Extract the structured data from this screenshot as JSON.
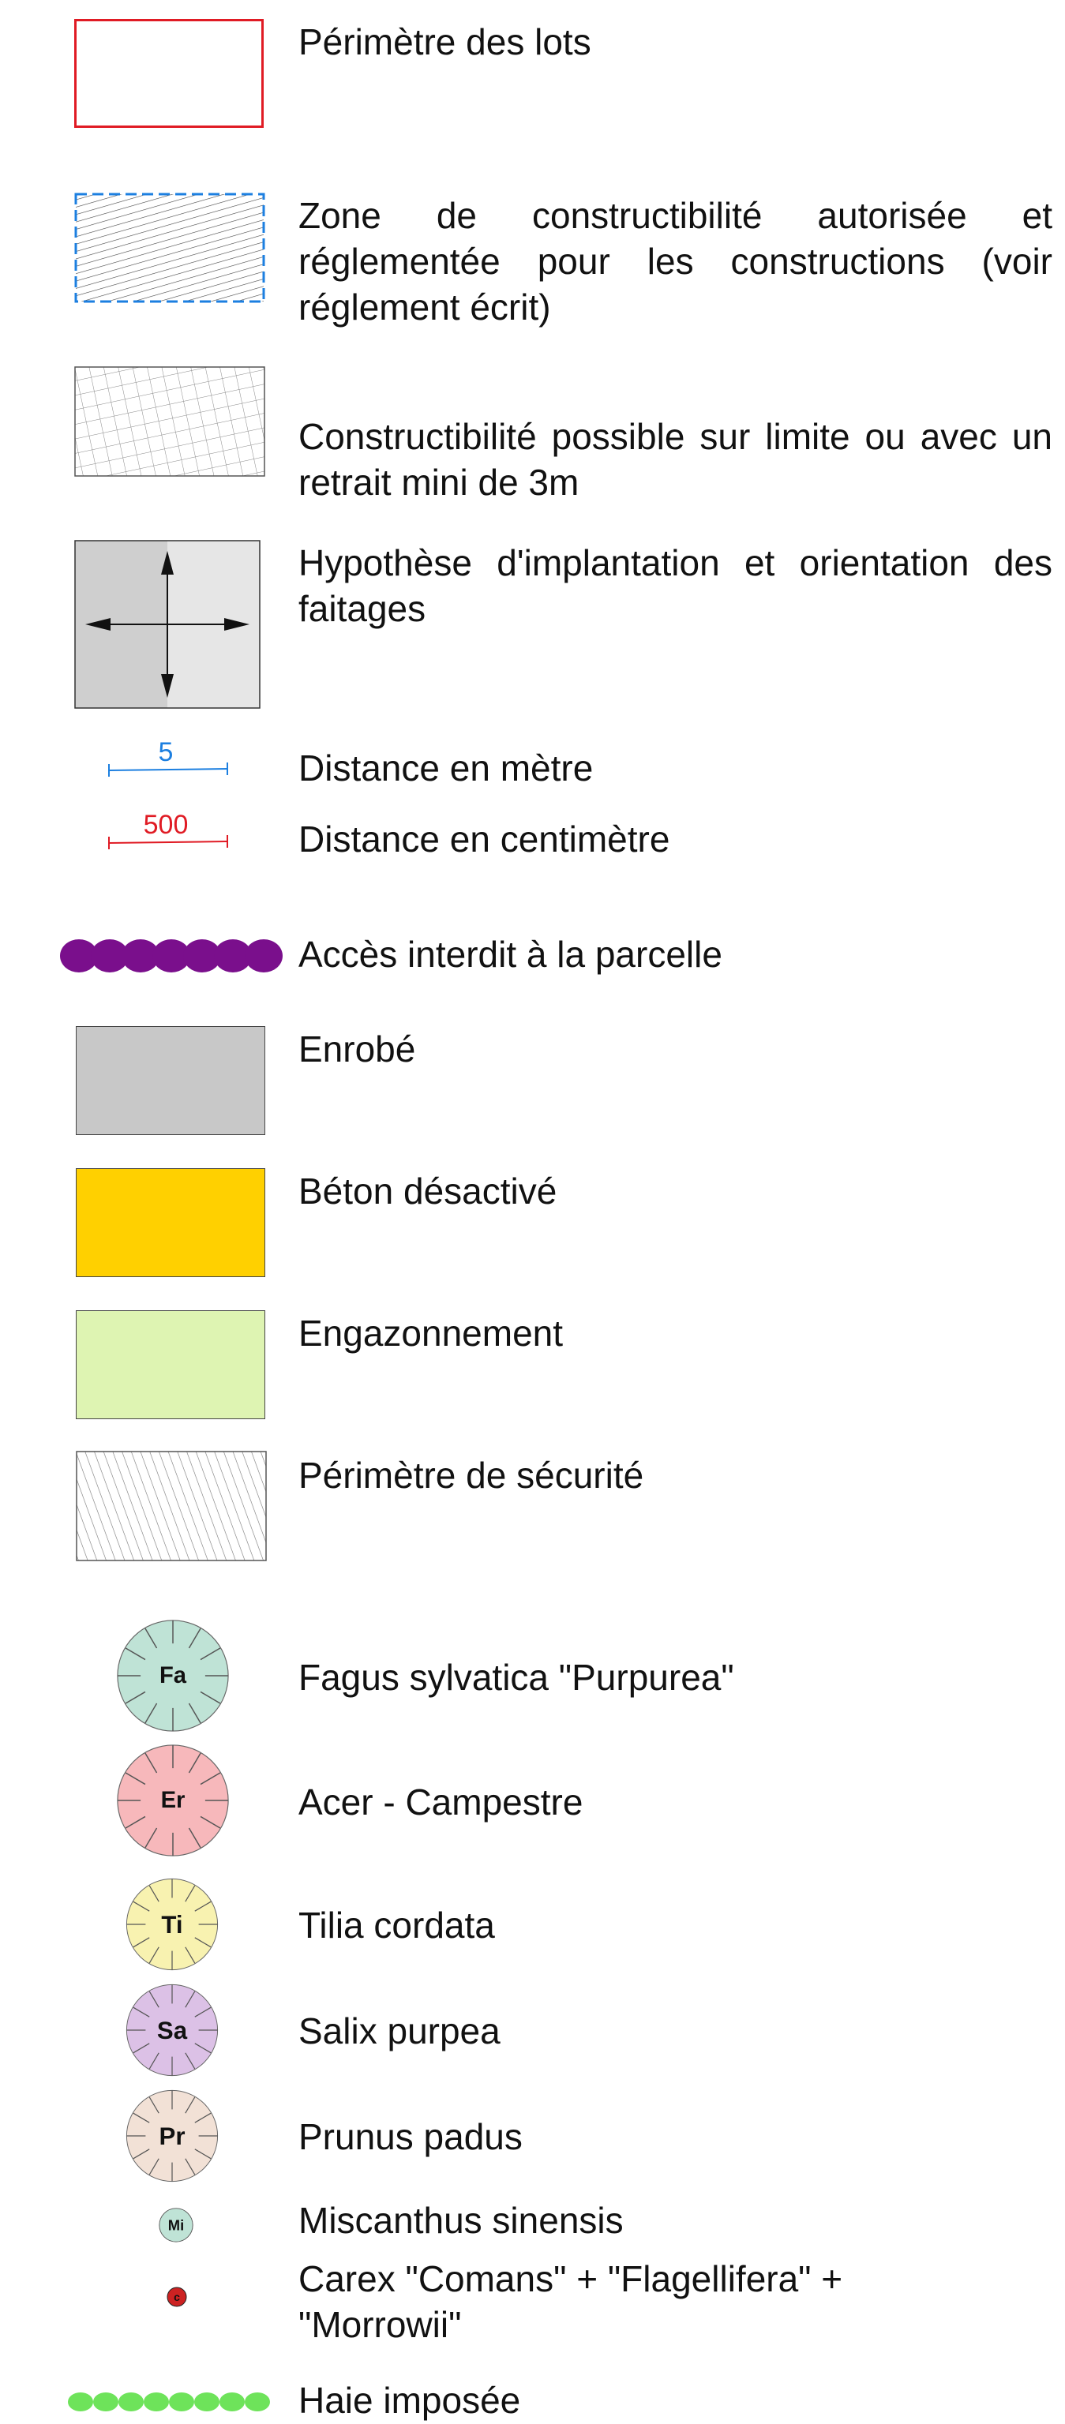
{
  "legend": {
    "items": [
      {
        "key": "perimetre_lots",
        "label": "Périmètre des lots",
        "color": "#e01b24"
      },
      {
        "key": "zone_constructibilite",
        "label": "Zone de constructibilité autorisée et réglementée pour les constructions (voir réglement écrit)",
        "color": "#1c7fe0"
      },
      {
        "key": "constructibilite_limite",
        "label": "Constructibilité possible sur limite ou avec un retrait mini de 3m"
      },
      {
        "key": "hypothese_implantation",
        "label": "Hypothèse d'implantation et orientation des faitages"
      },
      {
        "key": "distance_metre",
        "label": "Distance en mètre",
        "value": "5",
        "color": "#1c7fe0"
      },
      {
        "key": "distance_centimetre",
        "label": "Distance en centimètre",
        "value": "500",
        "color": "#e01b24"
      },
      {
        "key": "acces_interdit",
        "label": "Accès interdit à la parcelle",
        "color": "#7a0f8c"
      },
      {
        "key": "enrobe",
        "label": "Enrobé",
        "color": "#c8c8c8"
      },
      {
        "key": "beton_desactive",
        "label": "Béton désactivé",
        "color": "#ffd000"
      },
      {
        "key": "engazonnement",
        "label": "Engazonnement",
        "color": "#def4b2"
      },
      {
        "key": "perimetre_securite",
        "label": "Périmètre de sécurité"
      }
    ],
    "trees": [
      {
        "code": "Fa",
        "label": "Fagus sylvatica \"Purpurea\"",
        "color": "#bfe3d6"
      },
      {
        "code": "Er",
        "label": "Acer - Campestre",
        "color": "#f7b8bb"
      },
      {
        "code": "Ti",
        "label": "Tilia cordata",
        "color": "#f8f2b0"
      },
      {
        "code": "Sa",
        "label": "Salix purpea",
        "color": "#dcc1e6"
      },
      {
        "code": "Pr",
        "label": "Prunus padus",
        "color": "#f2e1d6"
      },
      {
        "code": "Mi",
        "label": "Miscanthus sinensis",
        "color": "#bfe3d6"
      },
      {
        "code": "c",
        "label": "Carex \"Comans\" + \"Flagellifera\" + \"Morrowii\"",
        "color": "#cc2222"
      }
    ],
    "hedge": {
      "label": "Haie imposée",
      "color": "#6ee35a"
    }
  }
}
